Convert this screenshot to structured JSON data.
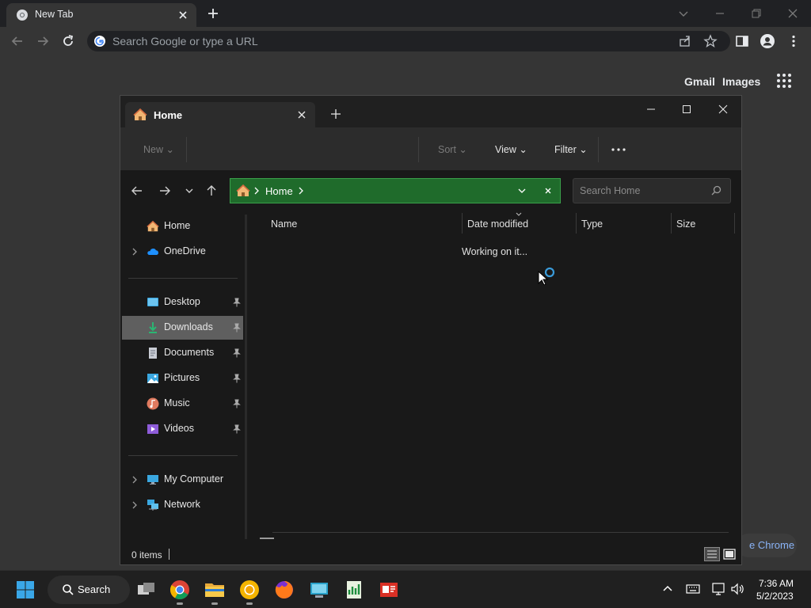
{
  "chrome": {
    "tab_title": "New Tab",
    "omnibox_placeholder": "Search Google or type a URL",
    "gmail": "Gmail",
    "images": "Images",
    "customize_partial": "e Chrome"
  },
  "explorer": {
    "tab_title": "Home",
    "commands": {
      "new": "New",
      "sort": "Sort",
      "view": "View",
      "filter": "Filter"
    },
    "address": "Home",
    "search_placeholder": "Search Home",
    "sidebar": {
      "home": "Home",
      "onedrive": "OneDrive",
      "desktop": "Desktop",
      "downloads": "Downloads",
      "documents": "Documents",
      "pictures": "Pictures",
      "music": "Music",
      "videos": "Videos",
      "my_computer": "My Computer",
      "network": "Network"
    },
    "columns": {
      "name": "Name",
      "date_modified": "Date modified",
      "type": "Type",
      "size": "Size"
    },
    "status_message": "Working on it...",
    "items_count": "0 items"
  },
  "taskbar": {
    "search_label": "Search",
    "time": "7:36 AM",
    "date": "5/2/2023"
  },
  "colors": {
    "accent": "#3a9bd9",
    "address_bg": "#1f6b2b",
    "selection": "#5f5f5f"
  }
}
